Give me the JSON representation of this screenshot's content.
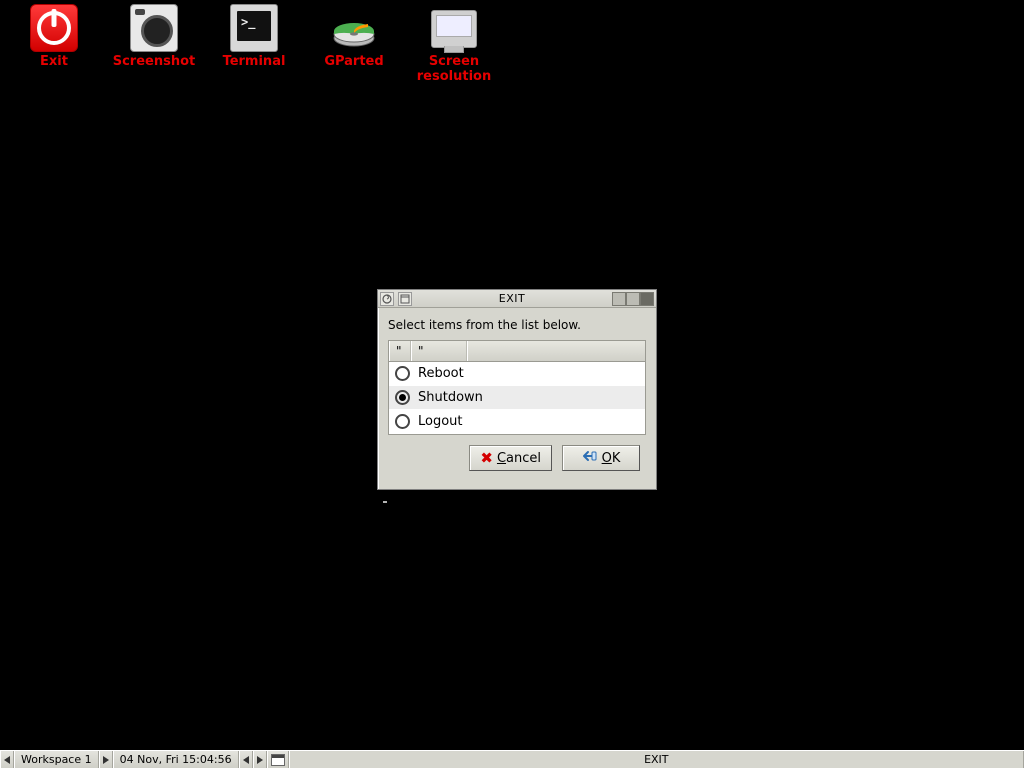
{
  "desktop": {
    "icons": [
      {
        "id": "exit",
        "label": "Exit"
      },
      {
        "id": "screenshot",
        "label": "Screenshot"
      },
      {
        "id": "terminal",
        "label": "Terminal"
      },
      {
        "id": "gparted",
        "label": "GParted"
      },
      {
        "id": "screenres",
        "label": "Screen resolution"
      }
    ]
  },
  "dialog": {
    "title": "EXIT",
    "instruction": "Select items from the list below.",
    "columns": [
      "\"",
      "\"",
      ""
    ],
    "options": [
      {
        "label": "Reboot",
        "checked": false
      },
      {
        "label": "Shutdown",
        "checked": true
      },
      {
        "label": "Logout",
        "checked": false
      }
    ],
    "buttons": {
      "cancel_prefix": "C",
      "cancel_rest": "ancel",
      "ok_prefix": "O",
      "ok_rest": "K"
    }
  },
  "taskbar": {
    "workspace": "Workspace 1",
    "clock": "04 Nov, Fri 15:04:56",
    "task": "EXIT"
  }
}
